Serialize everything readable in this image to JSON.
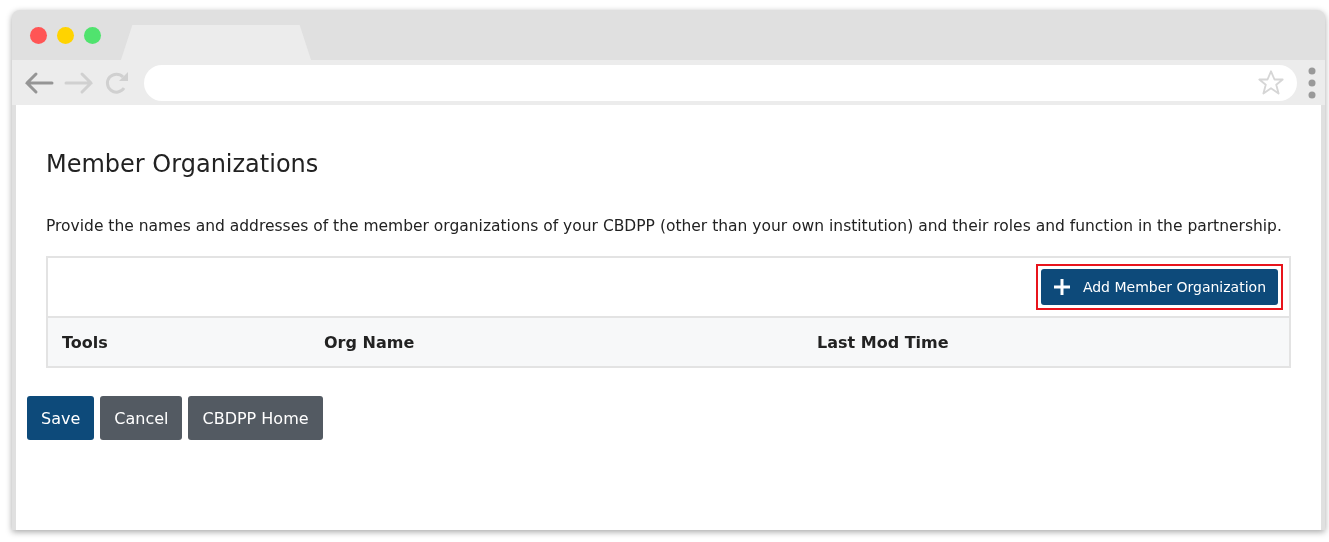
{
  "page": {
    "title": "Member Organizations",
    "description": "Provide the names and addresses of the member organizations of your CBDPP (other than your own institution) and their roles and function in the partnership."
  },
  "table": {
    "add_button": {
      "label": "Add Member Organization",
      "highlighted": true
    },
    "columns": [
      "Tools",
      "Org Name",
      "Last Mod Time"
    ]
  },
  "buttons": [
    {
      "label": "Save",
      "kind": "primary"
    },
    {
      "label": "Cancel",
      "kind": "secondary"
    },
    {
      "label": "CBDPP Home",
      "kind": "secondary"
    }
  ]
}
